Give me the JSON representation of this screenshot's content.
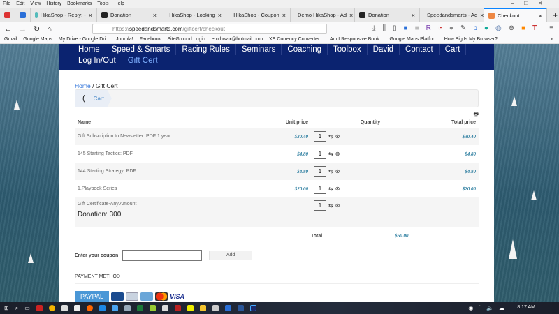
{
  "browser": {
    "menu": [
      "File",
      "Edit",
      "View",
      "History",
      "Bookmarks",
      "Tools",
      "Help"
    ],
    "tabs": [
      {
        "label": "HikaShop - Reply: -"
      },
      {
        "label": "Donation"
      },
      {
        "label": "HikaShop - Looking"
      },
      {
        "label": "HikaShop - Coupon"
      },
      {
        "label": "Demo HikaShop - Ad"
      },
      {
        "label": "Donation"
      },
      {
        "label": "Speedandsmarts - Ad"
      },
      {
        "label": "Checkout"
      }
    ],
    "url_prefix": "https://",
    "url_domain": "speedandsmarts.com",
    "url_path": "/giftcert/checkout",
    "bookmarks": [
      "Gmail",
      "Google Maps",
      "My Drive - Google Dri...",
      "Joomla!",
      "Facebook",
      "SiteGround Login",
      "erothwax@hotmail.com",
      "XE Currency Converter...",
      "Am I Responsive Book...",
      "Google Maps Platfor...",
      "How Big Is My Browser?"
    ]
  },
  "site": {
    "nav": [
      "Home",
      "Speed & Smarts",
      "Racing Rules",
      "Seminars",
      "Coaching",
      "Toolbox",
      "David",
      "Contact",
      "Cart",
      "Log In/Out",
      "Gift Cert"
    ],
    "breadcrumb": {
      "home": "Home",
      "sep": "/",
      "current": "Gift Cert"
    },
    "wizard_step": "Cart"
  },
  "cart": {
    "headers": {
      "name": "Name",
      "unit": "Unit price",
      "qty": "Quantity",
      "total": "Total price"
    },
    "rows": [
      {
        "name": "Gift Subscription to Newsletter: PDF 1 year",
        "unit": "$30.40",
        "qty": "1",
        "total": "$30.40"
      },
      {
        "name": "145 Starting Tactics: PDF",
        "unit": "$4.80",
        "qty": "1",
        "total": "$4.80"
      },
      {
        "name": "144 Starting Strategy: PDF",
        "unit": "$4.80",
        "qty": "1",
        "total": "$4.80"
      },
      {
        "name": "1.Playbook Series",
        "unit": "$20.00",
        "qty": "1",
        "total": "$20.00"
      },
      {
        "name": "Gift Certificate-Any Amount",
        "unit": "",
        "qty": "1",
        "total": "",
        "extra": "Donation: 300"
      }
    ],
    "total_label": "Total",
    "total_value": "$60.00"
  },
  "coupon": {
    "label": "Enter your coupon",
    "value": "",
    "button": "Add"
  },
  "payment": {
    "heading": "PAYMENT METHOD",
    "paypal": "PAYPAL",
    "visa": "VISA"
  },
  "taskbar": {
    "time": "8:17 AM"
  }
}
